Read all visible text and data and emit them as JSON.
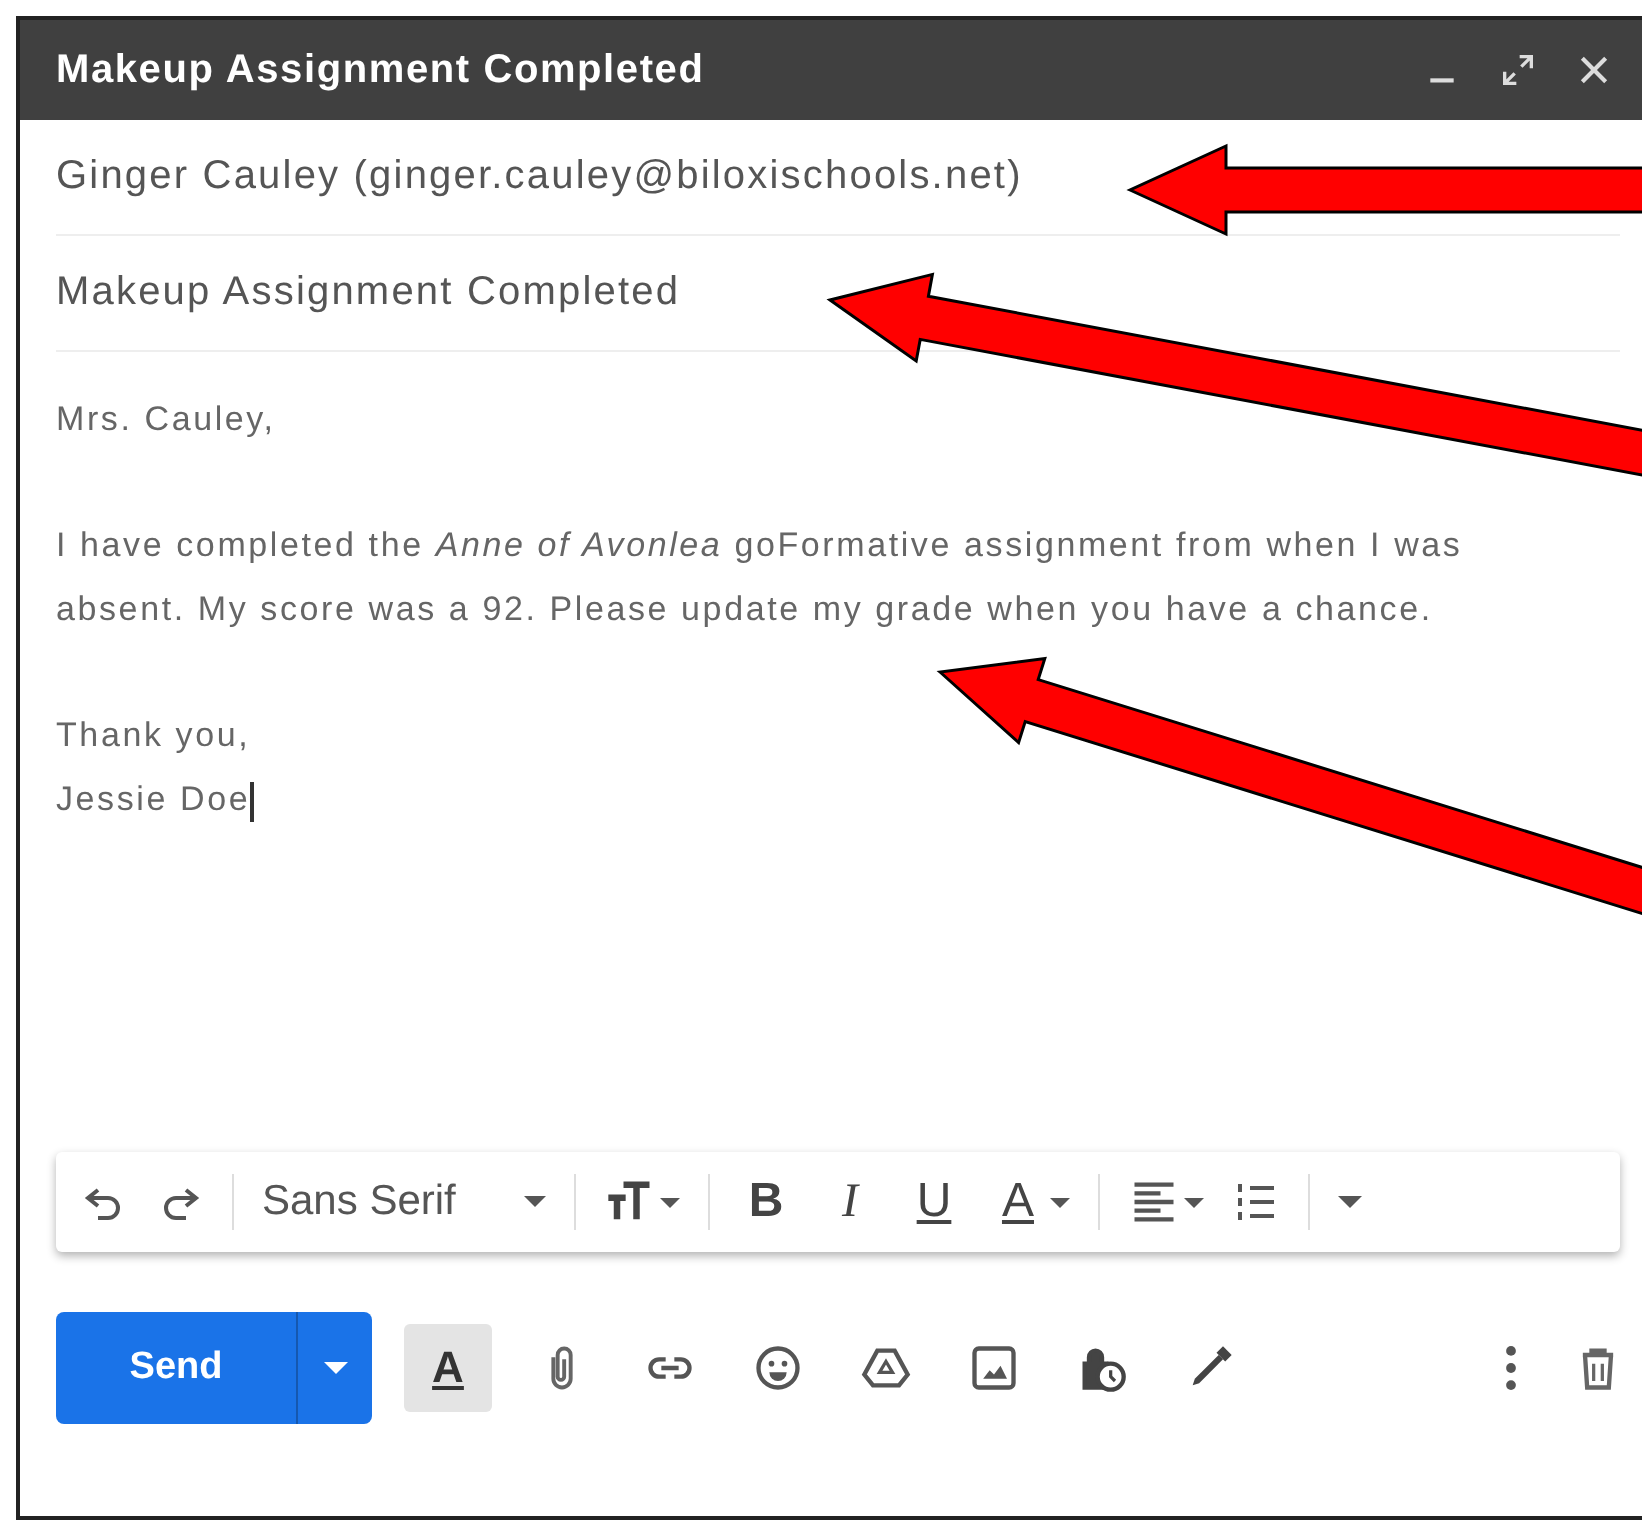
{
  "window": {
    "title": "Makeup Assignment Completed"
  },
  "recipients": "Ginger Cauley (ginger.cauley@biloxischools.net)",
  "subject": "Makeup Assignment Completed",
  "body": {
    "paragraphs": [
      [
        "Mrs. Cauley,"
      ],
      [
        "I have completed the *Anne of Avonlea* goFormative assignment from when I was absent. My score was a 92. Please update my grade when you have a chance."
      ],
      [
        "Thank you,",
        "Jessie Doe"
      ]
    ],
    "cursor": true
  },
  "toolbar": [
    {
      "kind": "undo"
    },
    {
      "kind": "redo"
    },
    {
      "kind": "separator"
    },
    {
      "kind": "font",
      "label": "Sans Serif"
    },
    {
      "kind": "separator"
    },
    {
      "kind": "size"
    },
    {
      "kind": "separator"
    },
    {
      "kind": "bold",
      "label": "B"
    },
    {
      "kind": "italic",
      "label": "I"
    },
    {
      "kind": "underline",
      "label": "U"
    },
    {
      "kind": "color",
      "label": "A"
    },
    {
      "kind": "separator"
    },
    {
      "kind": "align"
    },
    {
      "kind": "numbered"
    },
    {
      "kind": "separator"
    },
    {
      "kind": "more"
    }
  ],
  "send": {
    "label": "Send"
  },
  "format_toggle": {
    "label": "A",
    "selected": true
  },
  "actions": [
    {
      "kind": "attach"
    },
    {
      "kind": "link"
    },
    {
      "kind": "emoji"
    },
    {
      "kind": "drive"
    },
    {
      "kind": "photo"
    },
    {
      "kind": "confidential"
    },
    {
      "kind": "signature"
    }
  ],
  "right_actions": [
    {
      "kind": "more"
    },
    {
      "kind": "trash"
    }
  ]
}
